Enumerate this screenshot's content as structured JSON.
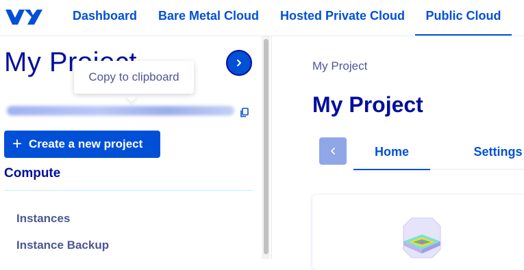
{
  "topnav": {
    "logo": "ovh-logo",
    "items": [
      {
        "label": "Dashboard",
        "active": false
      },
      {
        "label": "Bare Metal Cloud",
        "active": false
      },
      {
        "label": "Hosted Private Cloud",
        "active": false
      },
      {
        "label": "Public Cloud",
        "active": true
      }
    ],
    "accent_color": "#0050d7"
  },
  "sidebar": {
    "title": "My Project",
    "collapse_icon": "chevron-right-icon",
    "tooltip": "Copy to clipboard",
    "project_id_blurred": "xxxxxxxxxxxxxxxxxxxxxxxxxxxxxxxx",
    "copy_icon": "copy-icon",
    "create_button": {
      "icon": "plus-icon",
      "label": "Create a new project"
    },
    "section_heading": "Compute",
    "items": [
      {
        "label": "Instances"
      },
      {
        "label": "Instance Backup"
      }
    ]
  },
  "main": {
    "breadcrumb": "My Project",
    "title": "My Project",
    "tabs_prev_icon": "chevron-left-icon",
    "tabs": [
      {
        "label": "Home",
        "active": true
      },
      {
        "label": "Settings",
        "active": false
      }
    ],
    "card_illustration": "server-chip-illustration"
  },
  "colors": {
    "brand": "#0050d7",
    "heading": "#000e9c",
    "muted": "#4d5693"
  }
}
